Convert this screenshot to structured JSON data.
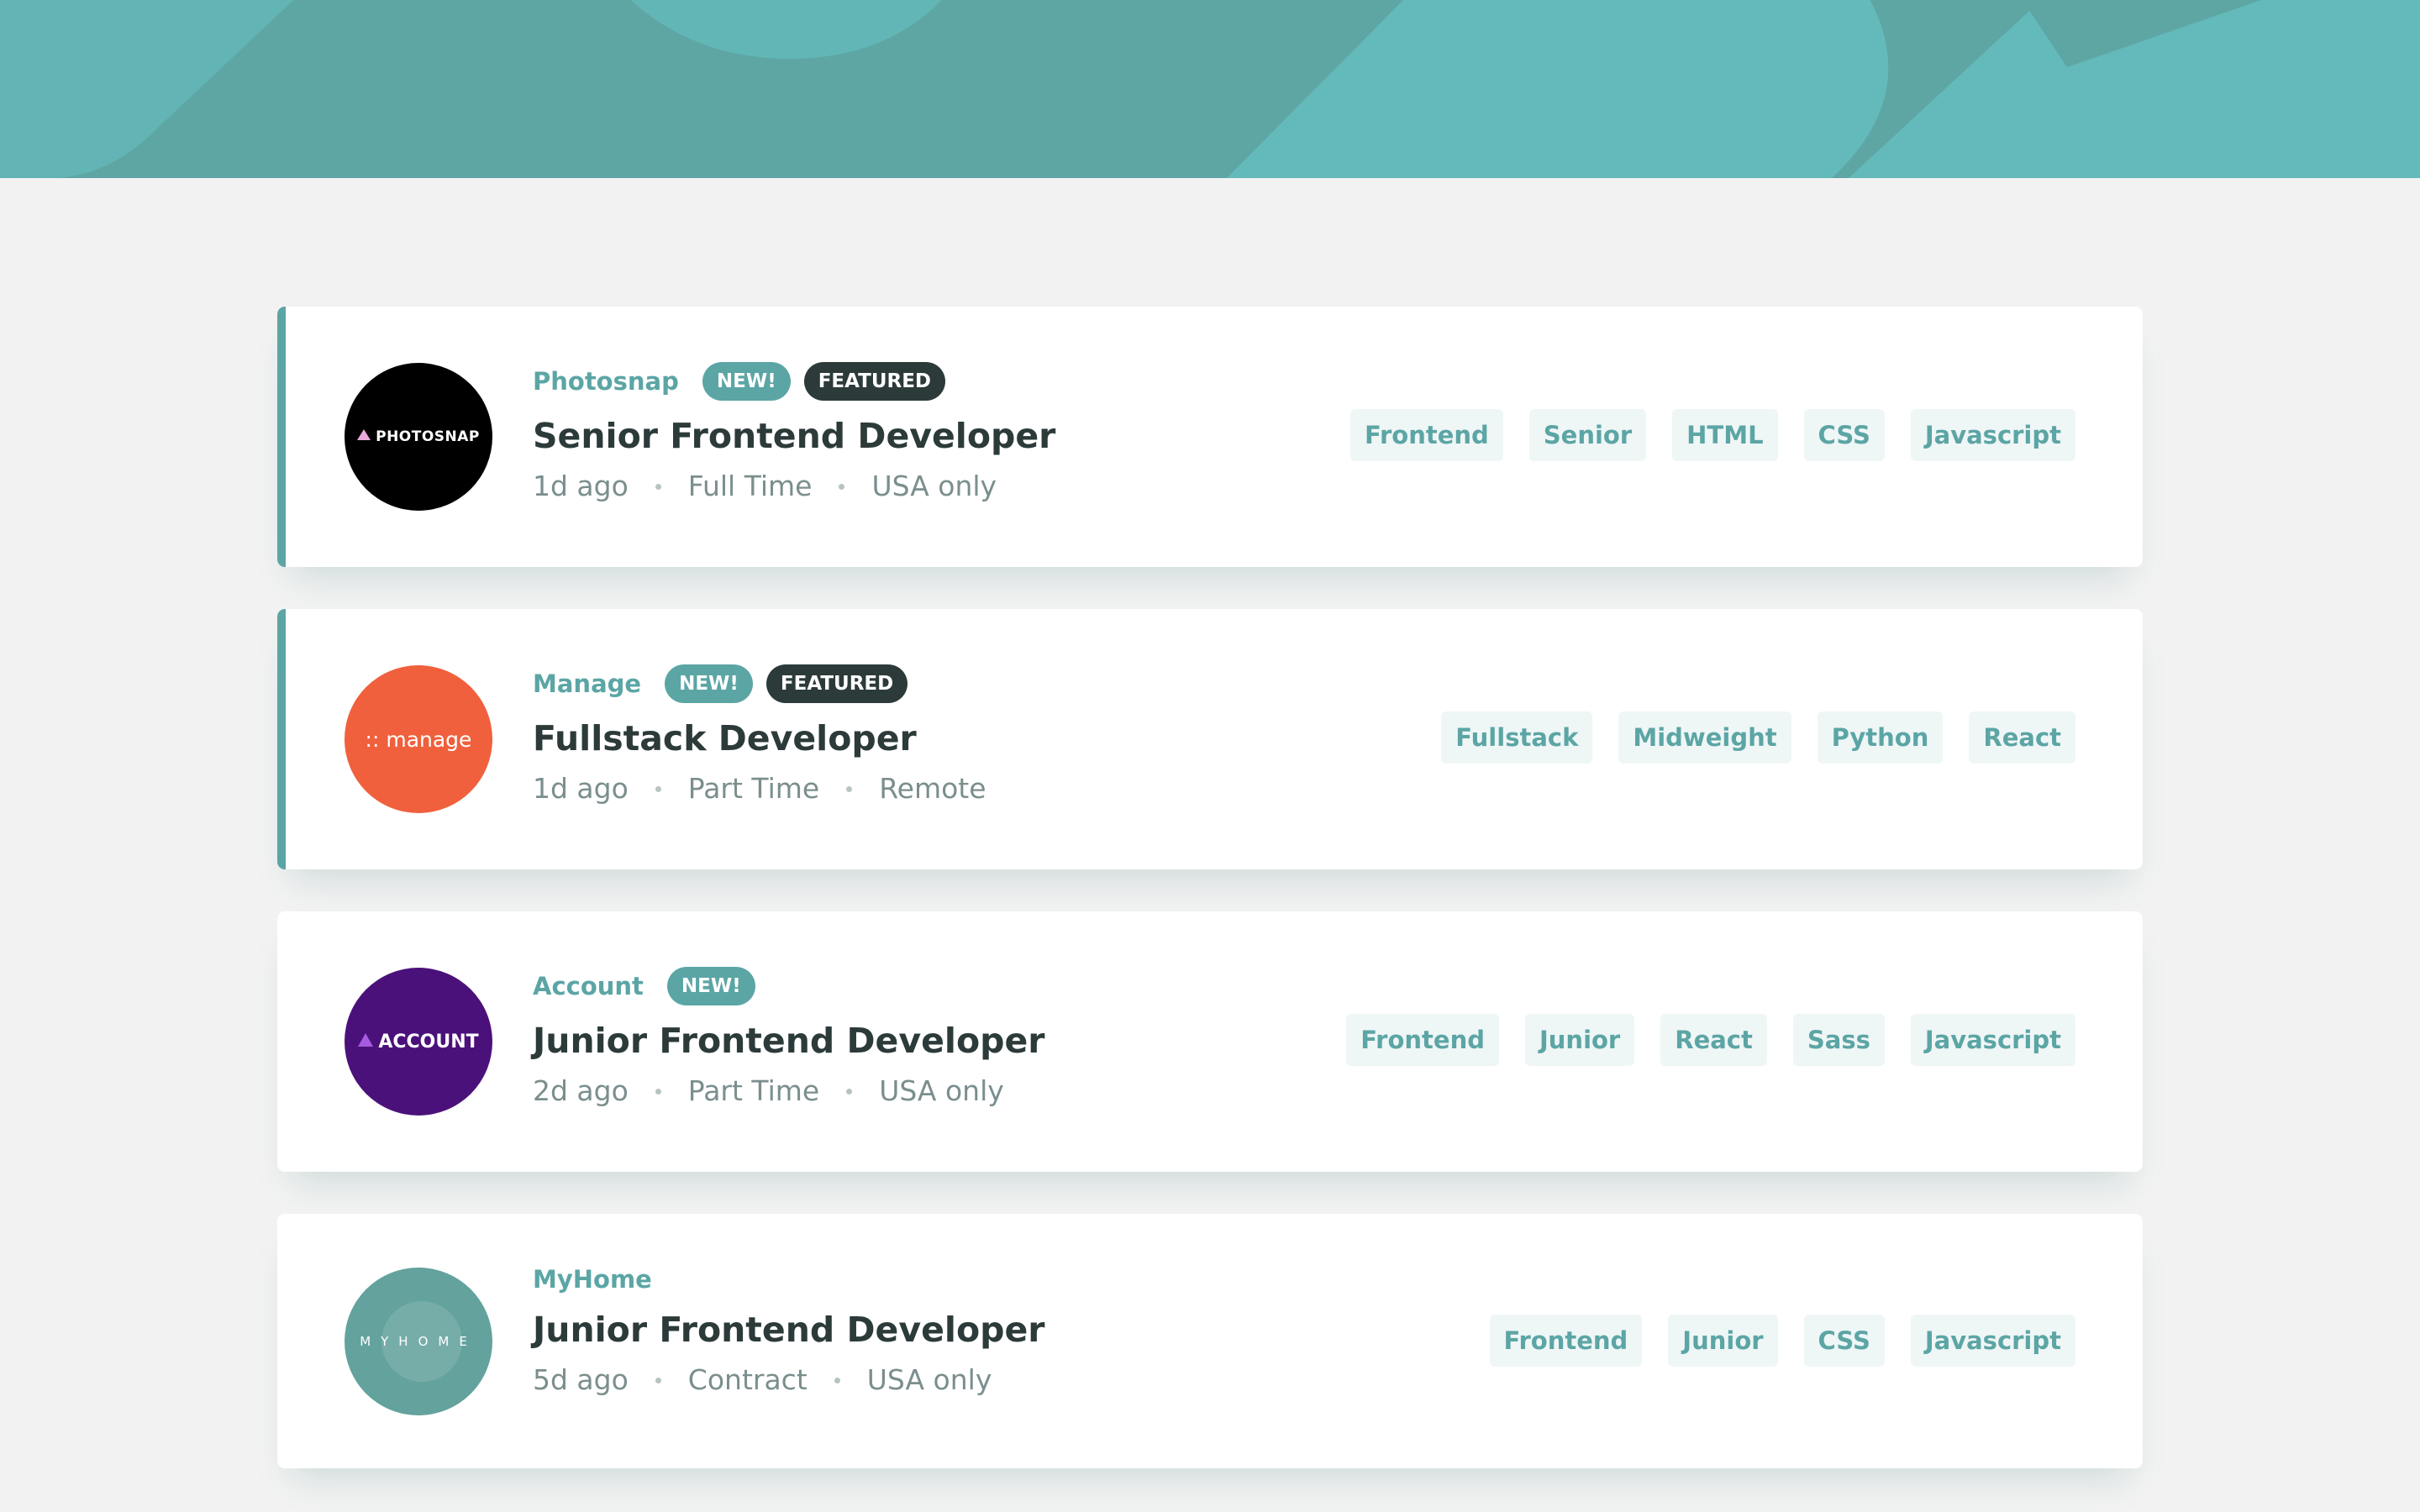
{
  "colors": {
    "primary": "#5ca5a5",
    "background": "#f2f2f2",
    "filter_tag_bg": "#eff6f6",
    "dark": "#2c3a3a",
    "muted": "#7b8e8e"
  },
  "jobs": [
    {
      "company": "Photosnap",
      "logo_text": "PHOTOSNAP",
      "logo_color": "#000000",
      "new_label": "NEW!",
      "featured_label": "FEATURED",
      "position": "Senior Frontend Developer",
      "posted_at": "1d ago",
      "contract": "Full Time",
      "location": "USA only",
      "tags": [
        "Frontend",
        "Senior",
        "HTML",
        "CSS",
        "Javascript"
      ]
    },
    {
      "company": "Manage",
      "logo_text": ":: manage",
      "logo_color": "#f0603d",
      "new_label": "NEW!",
      "featured_label": "FEATURED",
      "position": "Fullstack Developer",
      "posted_at": "1d ago",
      "contract": "Part Time",
      "location": "Remote",
      "tags": [
        "Fullstack",
        "Midweight",
        "Python",
        "React"
      ]
    },
    {
      "company": "Account",
      "logo_text": "ACCOUNT",
      "logo_color": "#4b117a",
      "new_label": "NEW!",
      "position": "Junior Frontend Developer",
      "posted_at": "2d ago",
      "contract": "Part Time",
      "location": "USA only",
      "tags": [
        "Frontend",
        "Junior",
        "React",
        "Sass",
        "Javascript"
      ]
    },
    {
      "company": "MyHome",
      "logo_text": "MYHOME",
      "logo_color": "#63a29d",
      "position": "Junior Frontend Developer",
      "posted_at": "5d ago",
      "contract": "Contract",
      "location": "USA only",
      "tags": [
        "Frontend",
        "Junior",
        "CSS",
        "Javascript"
      ]
    }
  ]
}
